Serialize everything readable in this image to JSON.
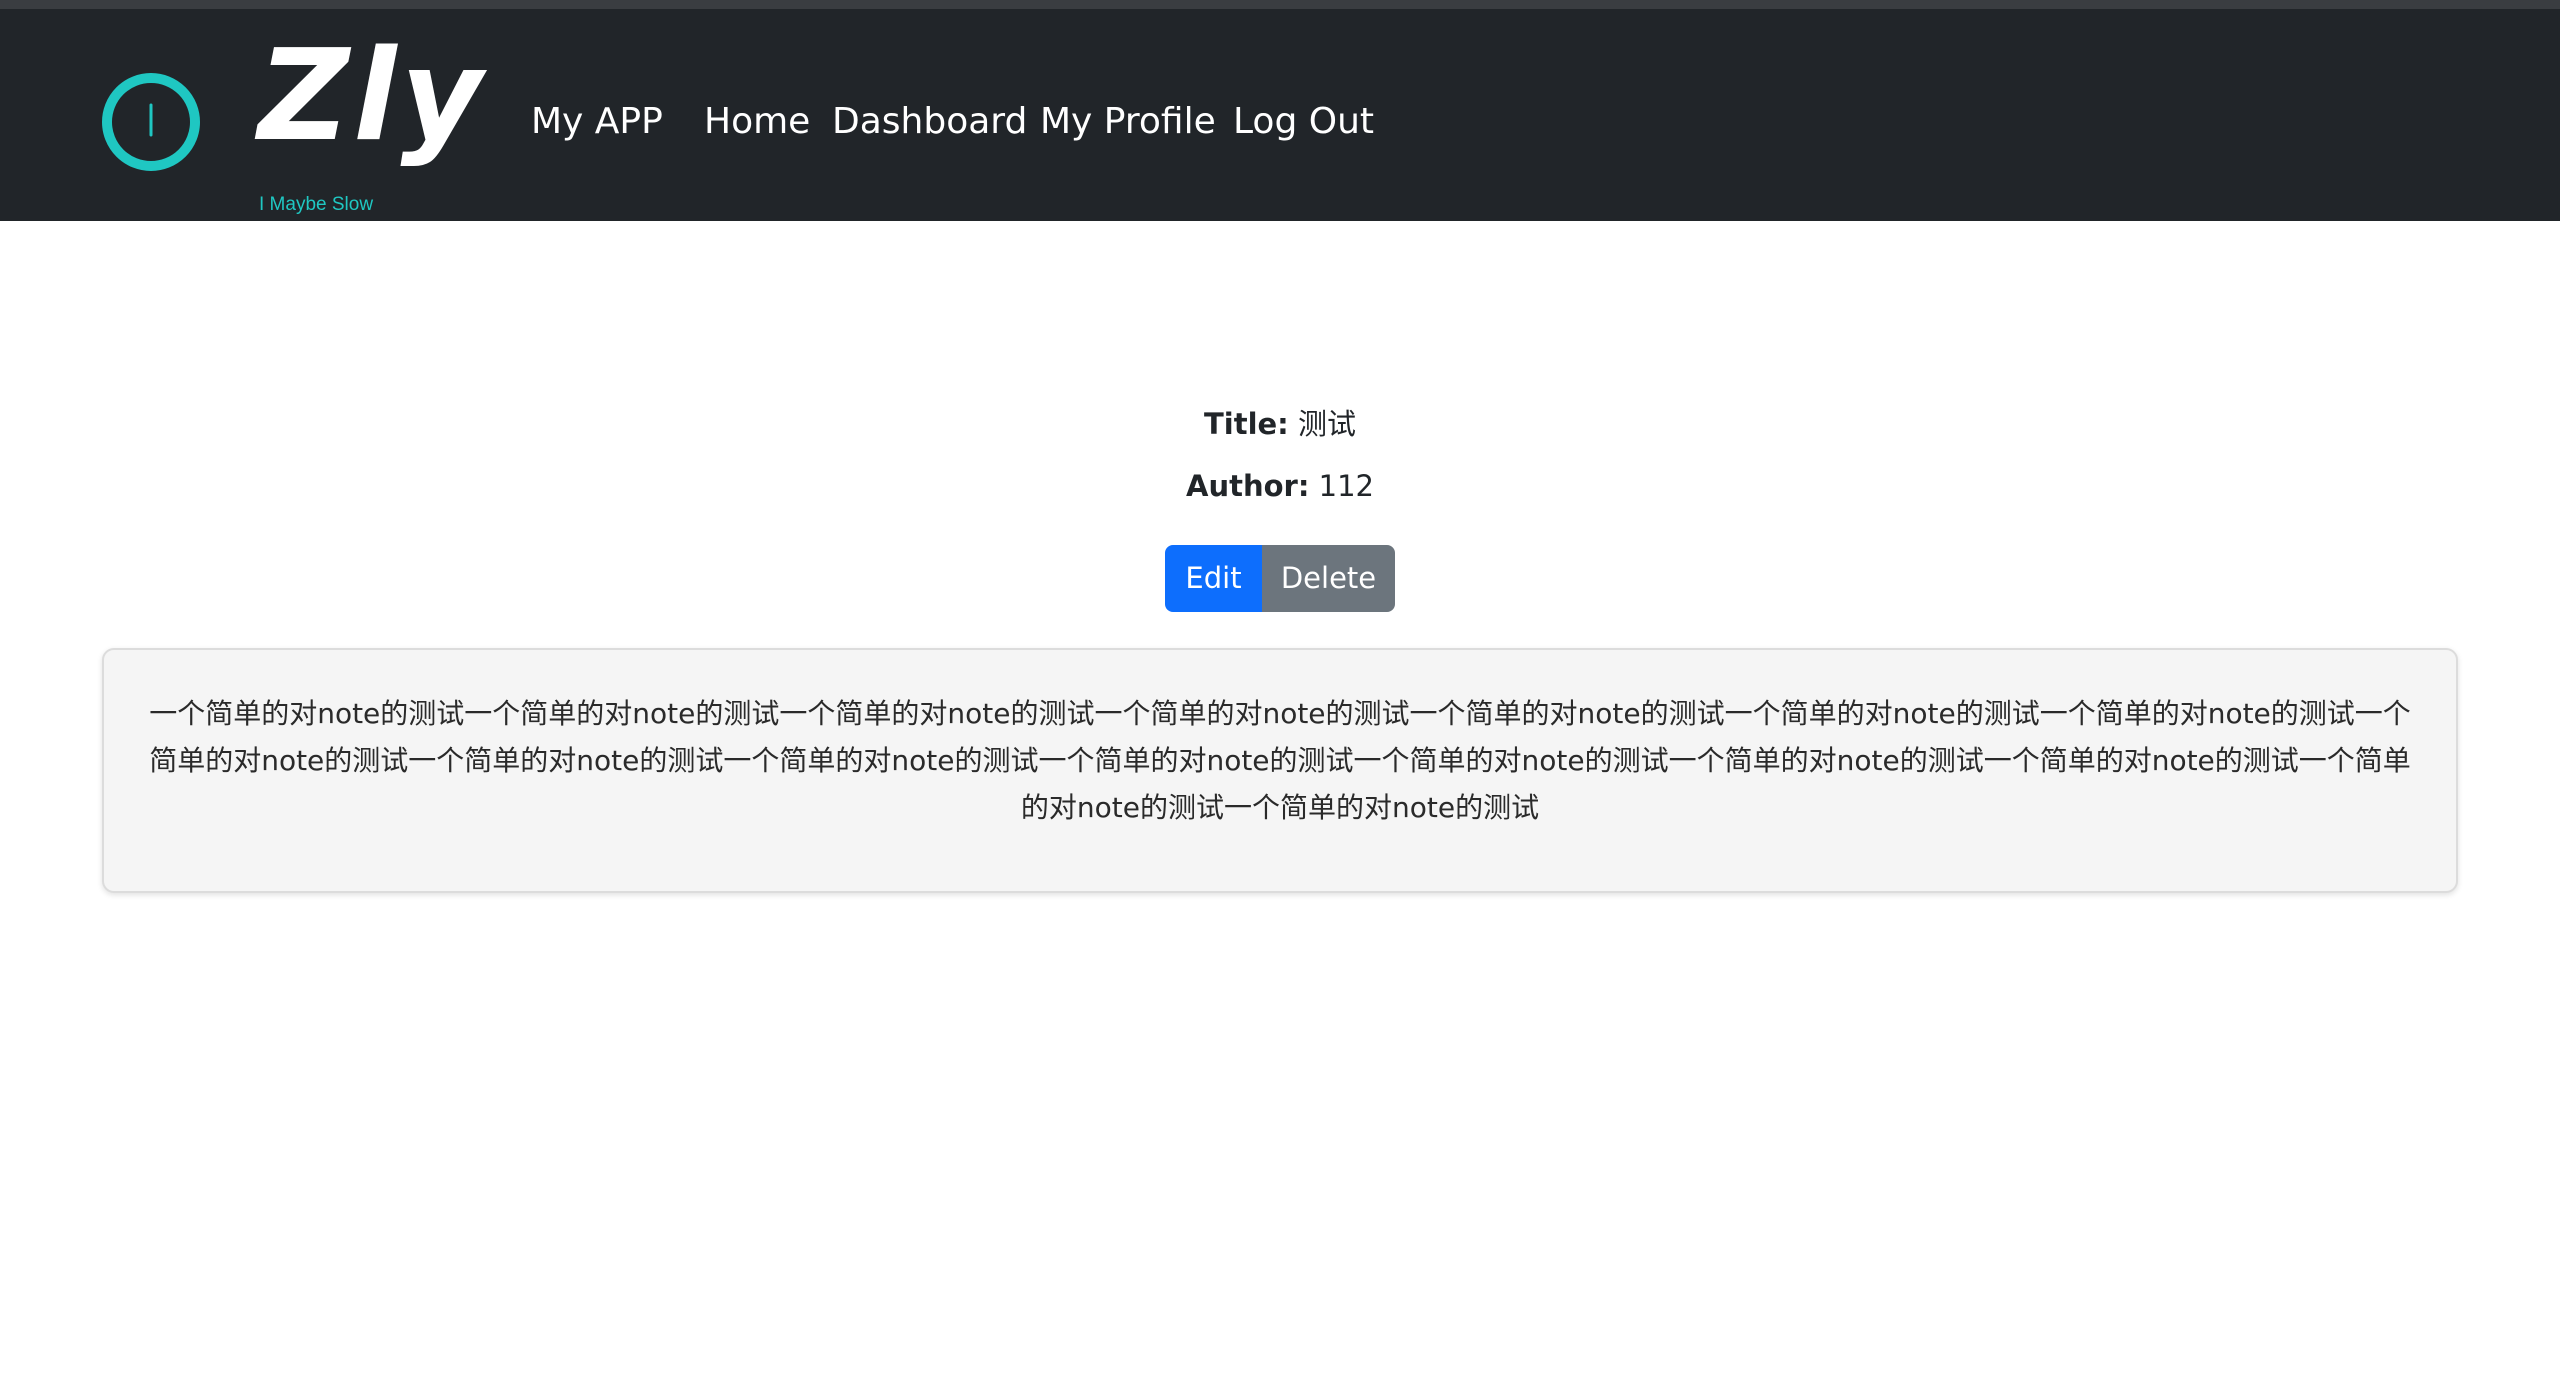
{
  "header": {
    "brand": "Zly",
    "tagline": "I Maybe Slow",
    "app_name": "My APP",
    "nav": {
      "home": "Home",
      "dashboard": "Dashboard",
      "profile": "My Profile",
      "logout": "Log Out"
    },
    "colors": {
      "background": "#212529",
      "accent": "#1fc7c2"
    }
  },
  "note": {
    "title_label": "Title:",
    "title_value": "测试",
    "author_label": "Author:",
    "author_value": "112",
    "edit_label": "Edit",
    "delete_label": "Delete",
    "content": "一个简单的对note的测试一个简单的对note的测试一个简单的对note的测试一个简单的对note的测试一个简单的对note的测试一个简单的对note的测试一个简单的对note的测试一个简单的对note的测试一个简单的对note的测试一个简单的对note的测试一个简单的对note的测试一个简单的对note的测试一个简单的对note的测试一个简单的对note的测试一个简单的对note的测试一个简单的对note的测试"
  },
  "colors": {
    "edit_button": "#0d6efd",
    "delete_button": "#6c757d"
  }
}
